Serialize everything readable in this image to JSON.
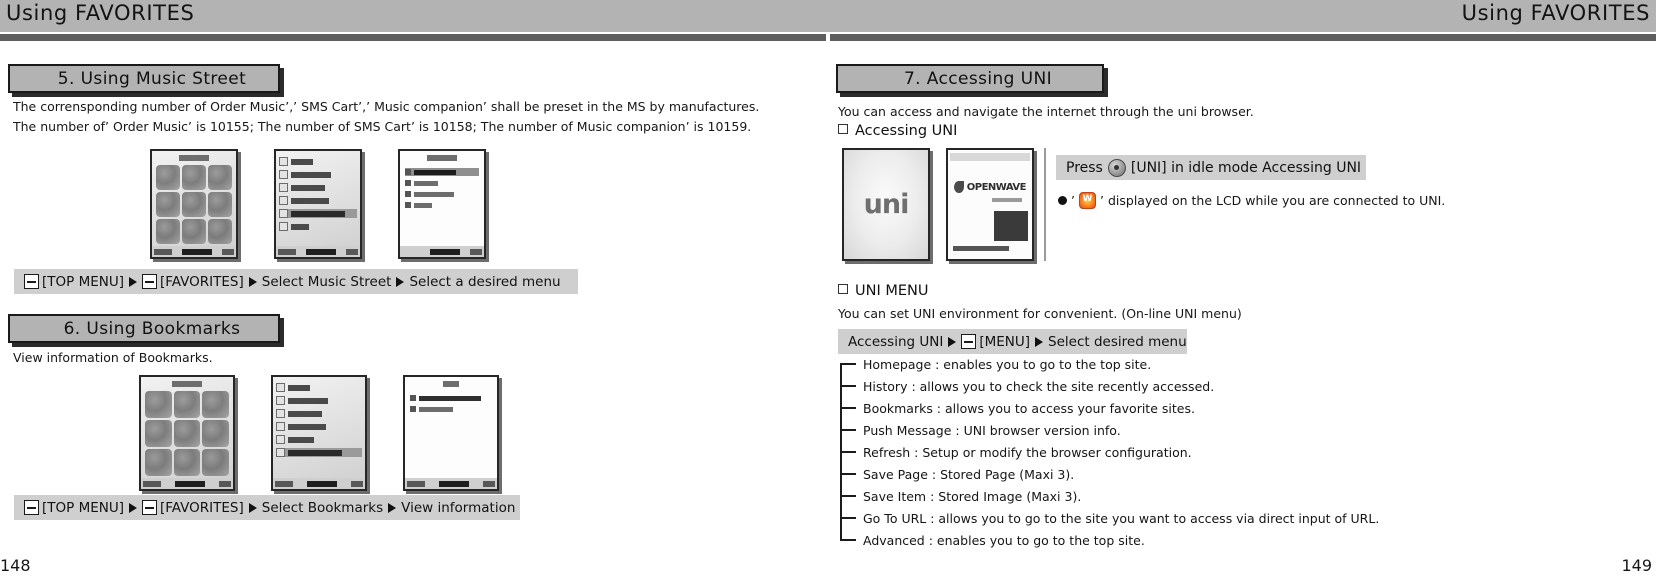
{
  "left_page": {
    "running_header": "Using FAVORITES",
    "folio": "148",
    "sections": [
      {
        "heading": "5. Using Music Street",
        "body": "The corrensponding number of Order Music’,’ SMS Cart’,’ Music companion’ shall be preset in the MS by manufactures. The number of’ Order Music’ is 10155; The number of SMS Cart’ is 10158; The number of Music companion’ is 10159.",
        "keypath": {
          "step1_label": "[TOP MENU]",
          "step2_label": "[FAVORITES]",
          "step3_label": "Select Music Street",
          "step4_label": "Select a desired menu",
          "softkey_icon": "softkey-minus-icon",
          "arrow_icon": "arrow-right-icon"
        }
      },
      {
        "heading": "6. Using Bookmarks",
        "body": "View information of Bookmarks.",
        "keypath": {
          "step1_label": "[TOP MENU]",
          "step2_label": "[FAVORITES]",
          "step3_label": "Select Bookmarks",
          "step4_label": "View information",
          "softkey_icon": "softkey-minus-icon",
          "arrow_icon": "arrow-right-icon"
        }
      }
    ]
  },
  "right_page": {
    "running_header": "Using FAVORITES",
    "folio": "149",
    "section": {
      "heading": "7. Accessing UNI",
      "intro": "You can access and navigate the internet through the uni browser.",
      "sub_head_1": "Accessing UNI",
      "note_box": {
        "prefix": "Press",
        "key_icon": "uni-key-icon",
        "suffix": "[UNI] in idle mode Accessing UNI"
      },
      "note_line": {
        "bullet_icon": "filled-dot-icon",
        "quote_open": "’",
        "status_icon": "uni-connected-w-icon",
        "quote_close": "’",
        "text": "displayed on the LCD while you are connected to UNI."
      },
      "sub_head_2": "UNI MENU",
      "menu_intro": "You can set UNI environment for convenient. (On-line UNI menu)",
      "keypath": {
        "step1_label": "Accessing UNI",
        "step2_label": "[MENU]",
        "step3_label": "Select desired menu",
        "softkey_icon": "softkey-minus-icon",
        "arrow_icon": "arrow-right-icon"
      },
      "menu_items": [
        "Homepage : enables you to go to the top site.",
        "History : allows you to check the site recently accessed.",
        "Bookmarks : allows you to access your favorite sites.",
        "Push Message : UNI browser version info.",
        "Refresh : Setup or modify the browser configuration.",
        "Save Page : Stored Page (Maxi 3).",
        "Save Item : Stored Image (Maxi 3).",
        "Go To URL : allows you to go to the site you want to access via direct input of URL.",
        "Advanced : enables you to go to the top site."
      ]
    }
  },
  "screenshots": {
    "uni_splash_text": "uni",
    "openwave_text": "OPENWAVE"
  },
  "colors": {
    "header_band": "#b3b3b3",
    "rule_dark": "#5e5e5e",
    "plate_fill": "#b3b3b3",
    "keypath_fill": "#cfcfcf",
    "text": "#141414",
    "status_icon": "#ff8a1f"
  }
}
